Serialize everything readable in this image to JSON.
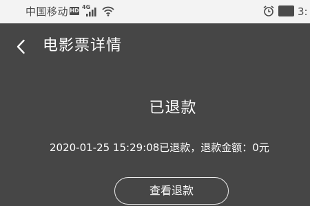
{
  "status_bar": {
    "carrier": "中国移动",
    "hd_badge": "HD",
    "network": "4G",
    "time": "3:"
  },
  "header": {
    "title": "电影票详情"
  },
  "main": {
    "status": "已退款",
    "refund_info": "2020-01-25 15:29:08已退款，退款金额：0元",
    "view_refund_label": "查看退款"
  }
}
